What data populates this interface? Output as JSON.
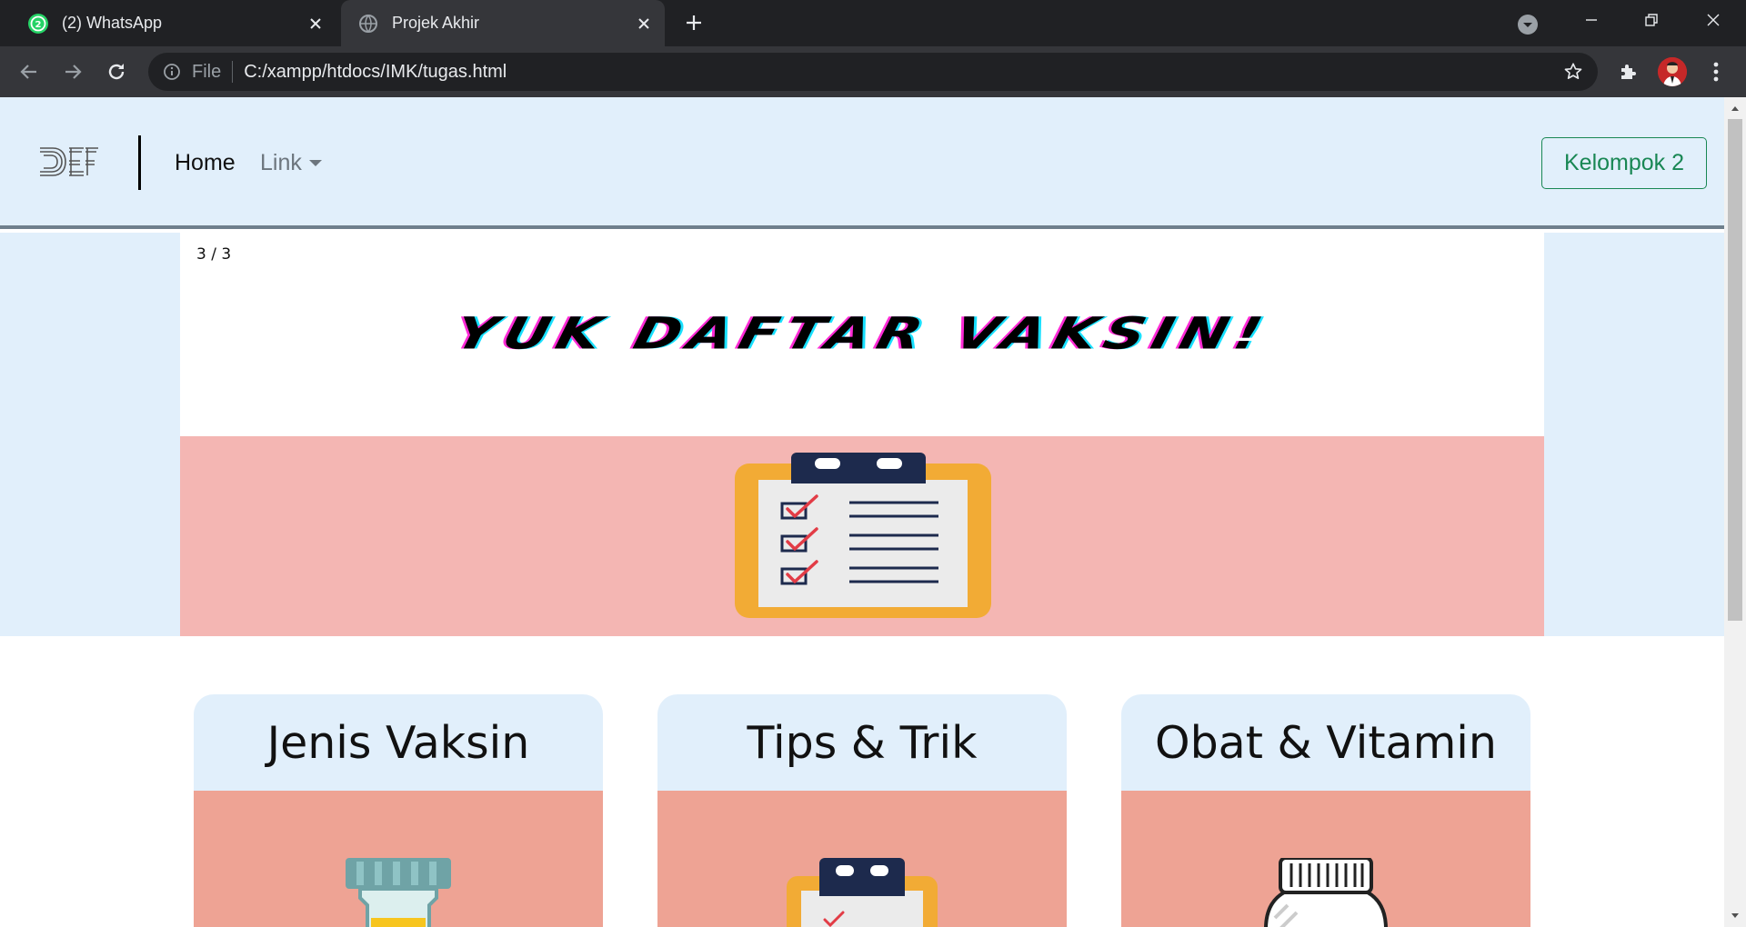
{
  "browser": {
    "tabs": [
      {
        "label": "(2) WhatsApp",
        "badge": "2",
        "active": false
      },
      {
        "label": "Projek Akhir",
        "active": true
      }
    ],
    "omnibox": {
      "scheme_label": "File",
      "url": "C:/xampp/htdocs/IMK/tugas.html"
    }
  },
  "navbar": {
    "brand_text": "DEF",
    "home_label": "Home",
    "link_label": "Link",
    "group_button_label": "Kelompok 2"
  },
  "carousel": {
    "counter": "3 / 3",
    "headline": "YUK DAFTAR VAKSIN!"
  },
  "cards": [
    {
      "title": "Jenis Vaksin",
      "image_icon": "vaccine-bottle-icon"
    },
    {
      "title": "Tips & Trik",
      "image_icon": "clipboard-icon"
    },
    {
      "title": "Obat & Vitamin",
      "image_icon": "pill-bottle-icon"
    }
  ],
  "colors": {
    "navbar_bg": "#e1effb",
    "slide_pink": "#f4b6b3",
    "card_body": "#eea394",
    "success": "#198754",
    "chrome_dark": "#202124",
    "chrome_mid": "#35363a"
  }
}
